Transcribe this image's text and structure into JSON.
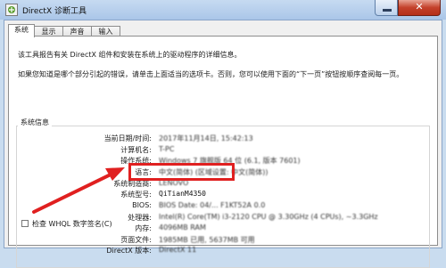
{
  "window": {
    "title": "DirectX 诊断工具",
    "close_glyph": "✕"
  },
  "tabs": [
    {
      "label": "系统"
    },
    {
      "label": "显示"
    },
    {
      "label": "声音"
    },
    {
      "label": "输入"
    }
  ],
  "intro": {
    "line1": "该工具报告有关 DirectX 组件和安装在系统上的驱动程序的详细信息。",
    "line2": "如果您知道是哪个部分引起的错误，请单击上面适当的选项卡。否则，您可以使用下面的“下一页”按钮按顺序查阅每一页。"
  },
  "system_info": {
    "title": "系统信息",
    "rows": [
      {
        "label": "当前日期/时间:",
        "value": "2017年11月14日, 15:42:13"
      },
      {
        "label": "计算机名:",
        "value": "T-PC"
      },
      {
        "label": "操作系统:",
        "value": "Windows 7 旗舰版 64 位 (6.1, 版本 7601)"
      },
      {
        "label": "语言:",
        "value": "中文(简体) (区域设置: 中文(简体))"
      },
      {
        "label": "系统制造商:",
        "value": "LENOVO"
      },
      {
        "label": "系统型号:",
        "value": "QiTianM4350"
      },
      {
        "label": "BIOS:",
        "value": "BIOS Date: 04/... F1KT52A 0.0"
      },
      {
        "label": "处理器:",
        "value": "Intel(R) Core(TM) i3-2120 CPU @ 3.30GHz (4 CPUs), ~3.3GHz"
      },
      {
        "label": "内存:",
        "value": "4096MB RAM"
      },
      {
        "label": "页面文件:",
        "value": "1985MB 已用, 5637MB 可用"
      },
      {
        "label": "DirectX 版本:",
        "value": "DirectX 11"
      }
    ]
  },
  "whql": {
    "label": "检查 WHQL 数字签名(C)"
  },
  "colors": {
    "highlight": "#e02020",
    "arrow": "#e02020"
  }
}
